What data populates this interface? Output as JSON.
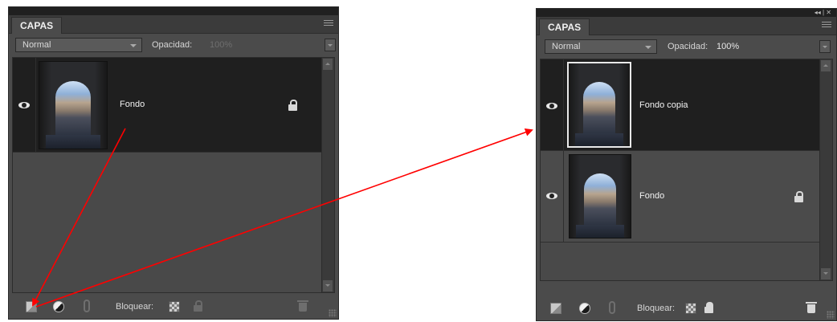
{
  "colors": {
    "arrow": "#ff0000",
    "panel_bg": "#4b4b4b",
    "selected_layer_bg": "#1f1f1f"
  },
  "left_panel": {
    "tab_label": "CAPAS",
    "blend_mode": "Normal",
    "opacity_label": "Opacidad:",
    "opacity_value": "100%",
    "opacity_enabled": false,
    "layers": [
      {
        "name": "Fondo",
        "visible": true,
        "locked": true,
        "selected": true
      }
    ],
    "lock_label": "Bloquear:"
  },
  "right_panel": {
    "window_controls": "◂◂ | ✕",
    "tab_label": "CAPAS",
    "blend_mode": "Normal",
    "opacity_label": "Opacidad:",
    "opacity_value": "100%",
    "opacity_enabled": true,
    "layers": [
      {
        "name": "Fondo copia",
        "visible": true,
        "locked": false,
        "selected": true
      },
      {
        "name": "Fondo",
        "visible": true,
        "locked": true,
        "selected": false
      }
    ],
    "lock_label": "Bloquear:"
  },
  "icons": [
    "eye-icon",
    "lock-icon",
    "new-layer-icon",
    "adjustment-layer-icon",
    "link-icon",
    "lock-transparency-icon",
    "lock-all-icon",
    "trash-icon",
    "panel-menu-icon"
  ]
}
